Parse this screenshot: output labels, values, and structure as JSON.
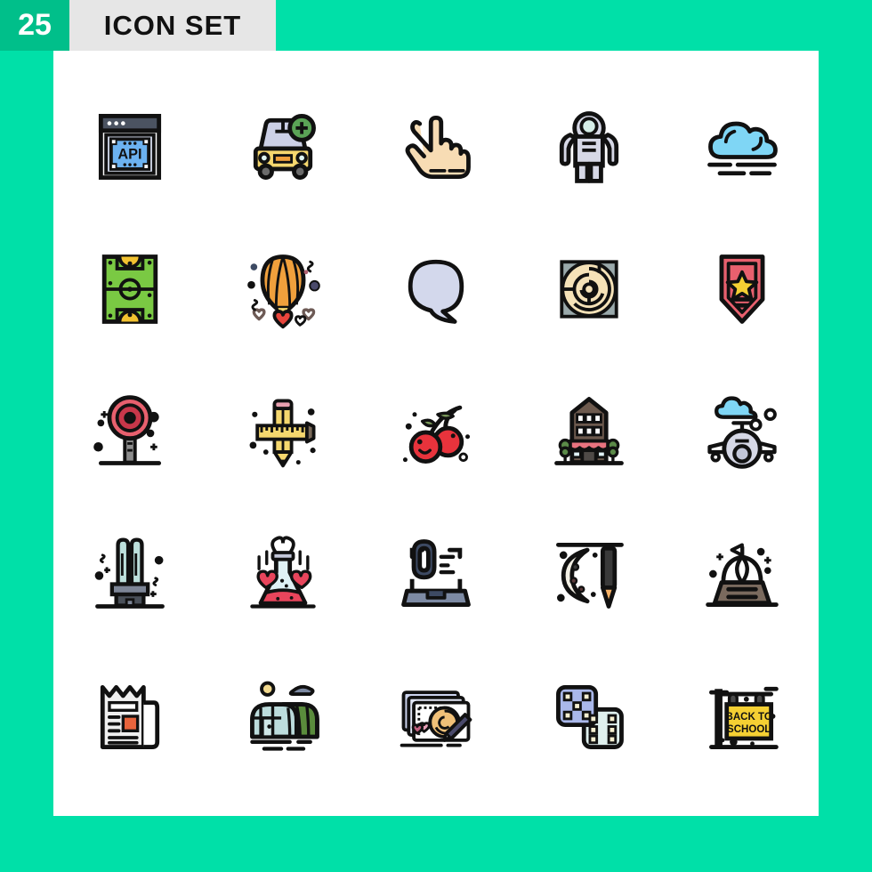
{
  "header": {
    "count": "25",
    "title": "ICON SET"
  },
  "theme": {
    "background": "#00e0a8",
    "count_box": "#00bf8a",
    "title_box": "#e6e6e6",
    "panel": "#ffffff",
    "stroke": "#111111"
  },
  "grid": {
    "columns": 5,
    "rows": 5,
    "total": 25
  },
  "icons": [
    {
      "index": 1,
      "name": "api-window-icon",
      "label": "API",
      "row": 1,
      "col": 1,
      "colors": [
        "#6cb2f0",
        "#c9d0e0",
        "#3d4654"
      ]
    },
    {
      "index": 2,
      "name": "add-car-icon",
      "label": "Add Car",
      "row": 1,
      "col": 2,
      "colors": [
        "#f5d76e",
        "#ccd0e6",
        "#5aa356"
      ]
    },
    {
      "index": 3,
      "name": "hand-gesture-icon",
      "label": "Tap Gesture",
      "row": 1,
      "col": 3,
      "colors": [
        "#f7dcb4"
      ]
    },
    {
      "index": 4,
      "name": "astronaut-icon",
      "label": "Astronaut",
      "row": 1,
      "col": 4,
      "colors": [
        "#d6d8e6",
        "#d6eee8"
      ]
    },
    {
      "index": 5,
      "name": "fog-cloud-icon",
      "label": "Fog",
      "row": 1,
      "col": 5,
      "colors": [
        "#7fd6f5"
      ]
    },
    {
      "index": 6,
      "name": "soccer-field-icon",
      "label": "Soccer Field",
      "row": 2,
      "col": 1,
      "colors": [
        "#7ac943",
        "#f2c230"
      ]
    },
    {
      "index": 7,
      "name": "hot-air-balloon-icon",
      "label": "Hot Air Balloon",
      "row": 2,
      "col": 2,
      "colors": [
        "#f0a03c",
        "#f5d76e",
        "#e8453c"
      ]
    },
    {
      "index": 8,
      "name": "speech-bubble-icon",
      "label": "Chat Bubble",
      "row": 2,
      "col": 3,
      "colors": [
        "#d3d8ec"
      ]
    },
    {
      "index": 9,
      "name": "maze-icon",
      "label": "Maze",
      "row": 2,
      "col": 4,
      "colors": [
        "#f5e2b8",
        "#9aa9ab"
      ]
    },
    {
      "index": 10,
      "name": "rank-badge-icon",
      "label": "Rank Badge",
      "row": 2,
      "col": 5,
      "colors": [
        "#e8606e",
        "#f5d033"
      ]
    },
    {
      "index": 11,
      "name": "lollipop-icon",
      "label": "Lollipop",
      "row": 3,
      "col": 1,
      "colors": [
        "#e8606e",
        "#c8374a",
        "#8c8c8c"
      ]
    },
    {
      "index": 12,
      "name": "pencil-ruler-icon",
      "label": "Pencil and Ruler",
      "row": 3,
      "col": 2,
      "colors": [
        "#f5d76e",
        "#f0a03c",
        "#7a6a5a"
      ]
    },
    {
      "index": 13,
      "name": "cherries-icon",
      "label": "Cherries",
      "row": 3,
      "col": 3,
      "colors": [
        "#e8333c",
        "#7b9a5a"
      ]
    },
    {
      "index": 14,
      "name": "shop-building-icon",
      "label": "Shop Building",
      "row": 3,
      "col": 4,
      "colors": [
        "#6d5a4e",
        "#e8737f",
        "#4f4a47"
      ]
    },
    {
      "index": 15,
      "name": "airplane-cloud-icon",
      "label": "Airplane",
      "row": 3,
      "col": 5,
      "colors": [
        "#d6d8e6",
        "#7fd6f5"
      ]
    },
    {
      "index": 16,
      "name": "cfl-bulb-icon",
      "label": "Energy Bulb",
      "row": 4,
      "col": 1,
      "colors": [
        "#bde0dc",
        "#4a5059"
      ]
    },
    {
      "index": 17,
      "name": "love-potion-flask-icon",
      "label": "Love Potion",
      "row": 4,
      "col": 2,
      "colors": [
        "#dff1f5",
        "#e8455c"
      ]
    },
    {
      "index": 18,
      "name": "phone-support-icon",
      "label": "Phone Support",
      "row": 4,
      "col": 3,
      "colors": [
        "#3d4a63",
        "#7d8aa3"
      ]
    },
    {
      "index": 19,
      "name": "moon-pen-icon",
      "label": "Moon and Pen",
      "row": 4,
      "col": 4,
      "colors": [
        "#f2efe4",
        "#3a3a3a",
        "#f7b267"
      ]
    },
    {
      "index": 20,
      "name": "sailboat-ride-icon",
      "label": "Sailboat",
      "row": 4,
      "col": 5,
      "colors": [
        "#7a6a5e",
        "#ffffff"
      ]
    },
    {
      "index": 21,
      "name": "newspaper-icon",
      "label": "Newspaper",
      "row": 5,
      "col": 1,
      "colors": [
        "#efefef",
        "#e8643c"
      ]
    },
    {
      "index": 22,
      "name": "greenhouse-icon",
      "label": "Greenhouse",
      "row": 5,
      "col": 2,
      "colors": [
        "#bcdcdc",
        "#5a8c3c",
        "#f2d98e"
      ]
    },
    {
      "index": 23,
      "name": "design-sketch-icon",
      "label": "Design Sketch",
      "row": 5,
      "col": 3,
      "colors": [
        "#ccd4ee",
        "#f0c078",
        "#e8a0b8"
      ]
    },
    {
      "index": 24,
      "name": "dice-icon",
      "label": "Dice",
      "row": 5,
      "col": 4,
      "colors": [
        "#aab8ea",
        "#dff0ee",
        "#f5efd0"
      ]
    },
    {
      "index": 25,
      "name": "back-to-school-sign-icon",
      "label": "BACK TO SCHOOL",
      "row": 5,
      "col": 5,
      "colors": [
        "#f5d033",
        "#222222"
      ],
      "text_lines": [
        "BACK TO",
        "SCHOOL"
      ]
    }
  ]
}
